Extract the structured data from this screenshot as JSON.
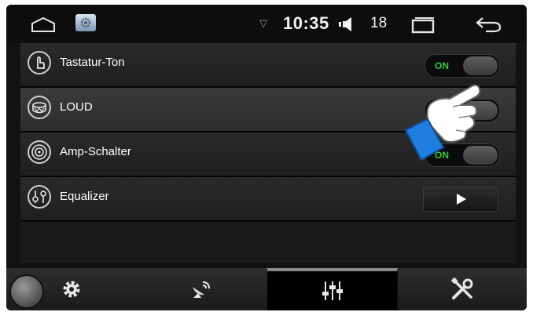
{
  "statusbar": {
    "time": "10:35",
    "volume": "18",
    "icons": [
      "home-outline-icon",
      "settings-app-icon",
      "wifi-icon",
      "volume-icon",
      "recent-apps-icon",
      "back-icon"
    ]
  },
  "settings": {
    "items": [
      {
        "label": "Tastatur-Ton",
        "icon": "touch-icon",
        "control": "toggle",
        "state": "ON"
      },
      {
        "label": "LOUD",
        "icon": "drum-icon",
        "control": "toggle",
        "state": ""
      },
      {
        "label": "Amp-Schalter",
        "icon": "speaker-icon",
        "control": "toggle",
        "state": "ON"
      },
      {
        "label": "Equalizer",
        "icon": "equalizer-knob-icon",
        "control": "arrow-button"
      }
    ]
  },
  "bottom_tabs": [
    {
      "name": "settings",
      "icon": "gear-icon",
      "active": false
    },
    {
      "name": "satellite",
      "icon": "satellite-dish-icon",
      "active": false
    },
    {
      "name": "equalizer",
      "icon": "sliders-icon",
      "active": true
    },
    {
      "name": "tools",
      "icon": "tools-icon",
      "active": false
    }
  ],
  "colors": {
    "background": "#121212",
    "row": "#2a2a2a",
    "on_text": "#37c837",
    "hand_cuff": "#1f7fe0"
  }
}
